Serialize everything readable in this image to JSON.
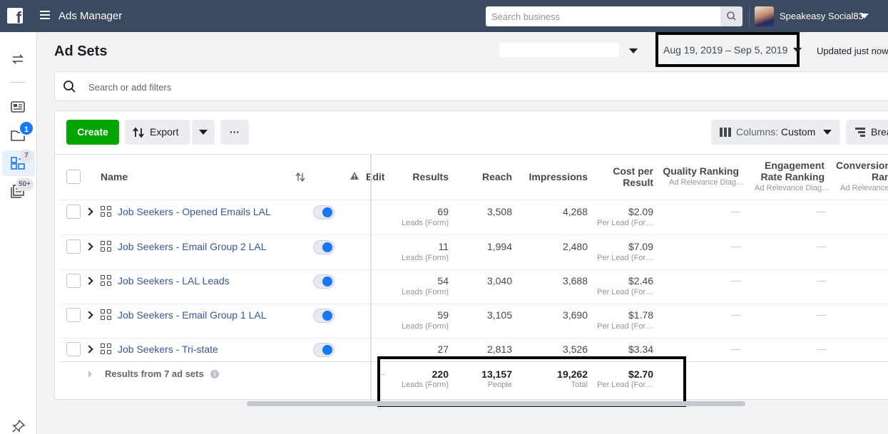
{
  "topbar": {
    "logo_letter": "f",
    "app_title": "Ads Manager",
    "search_placeholder": "Search business",
    "account_name": "Speakeasy Social83"
  },
  "leftrail": {
    "badge_notifications": "1",
    "badge_adsets": "7",
    "badge_more": "50+"
  },
  "header": {
    "title": "Ad Sets",
    "date_range": "Aug 19, 2019 – Sep 5, 2019",
    "updated": "Updated just now"
  },
  "filter": {
    "placeholder": "Search or add filters"
  },
  "toolbar": {
    "create_label": "Create",
    "export_label": "Export",
    "more_label": "···",
    "columns_label": "Columns:",
    "columns_value": "Custom",
    "breakdown_label": "Brea"
  },
  "columns": {
    "name": "Name",
    "edit": "Edit",
    "results": "Results",
    "reach": "Reach",
    "impressions": "Impressions",
    "cost_per_result": [
      "Cost per",
      "Result"
    ],
    "quality_ranking": "Quality Ranking",
    "quality_sub": "Ad Relevance Diag…",
    "engagement_ranking": [
      "Engagement",
      "Rate Ranking"
    ],
    "engagement_sub": "Ad Relevance Diag…",
    "conversion_ranking": [
      "Conversion",
      "Ran"
    ],
    "conversion_sub": "Ad Relevance"
  },
  "rows": [
    {
      "name": "Job Seekers - Opened Emails LAL",
      "results": "69",
      "results_sub": "Leads (Form)",
      "reach": "3,508",
      "impressions": "4,268",
      "cost": "$2.09",
      "cost_sub": "Per Lead (For…",
      "quality": "—",
      "engagement": "—"
    },
    {
      "name": "Job Seekers - Email Group 2 LAL",
      "results": "11",
      "results_sub": "Leads (Form)",
      "reach": "1,994",
      "impressions": "2,480",
      "cost": "$7.09",
      "cost_sub": "Per Lead (For…",
      "quality": "—",
      "engagement": "—"
    },
    {
      "name": "Job Seekers - LAL Leads",
      "results": "54",
      "results_sub": "Leads (Form)",
      "reach": "3,040",
      "impressions": "3,688",
      "cost": "$2.46",
      "cost_sub": "Per Lead (For…",
      "quality": "—",
      "engagement": "—"
    },
    {
      "name": "Job Seekers - Email Group 1 LAL",
      "results": "59",
      "results_sub": "Leads (Form)",
      "reach": "3,105",
      "impressions": "3,690",
      "cost": "$1.78",
      "cost_sub": "Per Lead (For…",
      "quality": "—",
      "engagement": "—"
    },
    {
      "name": "Job Seekers - Tri-state",
      "results": "27",
      "results_sub": "",
      "reach": "2,813",
      "impressions": "3,526",
      "cost": "$3.34",
      "cost_sub": "",
      "quality": "—",
      "engagement": "—"
    }
  ],
  "totals": {
    "label": "Results from 7 ad sets",
    "info_icon": "i",
    "results": "220",
    "results_sub": "Leads (Form)",
    "reach": "13,157",
    "reach_sub": "People",
    "impressions": "19,262",
    "impressions_sub": "Total",
    "cost": "$2.70",
    "cost_sub": "Per Lead (For…"
  }
}
